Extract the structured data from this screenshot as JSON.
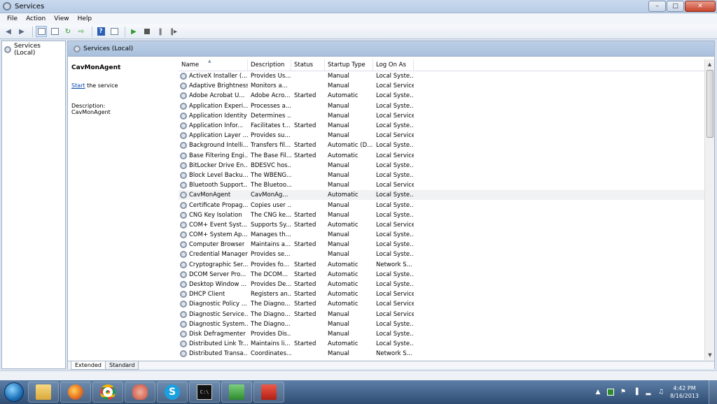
{
  "window": {
    "title": "Services"
  },
  "menu": [
    "File",
    "Action",
    "View",
    "Help"
  ],
  "tree": {
    "root": "Services (Local)"
  },
  "main": {
    "header": "Services (Local)"
  },
  "extended": {
    "service_name": "CavMonAgent",
    "start_link": "Start",
    "start_suffix": " the service",
    "desc_label": "Description:",
    "desc_value": "CavMonAgent"
  },
  "columns": {
    "name": "Name",
    "description": "Description",
    "status": "Status",
    "startup": "Startup Type",
    "logon": "Log On As"
  },
  "services": [
    [
      "ActiveX Installer (...",
      "Provides Us...",
      "",
      "Manual",
      "Local Syste..."
    ],
    [
      "Adaptive Brightness",
      "Monitors a...",
      "",
      "Manual",
      "Local Service"
    ],
    [
      "Adobe Acrobat U...",
      "Adobe Acro...",
      "Started",
      "Automatic",
      "Local Syste..."
    ],
    [
      "Application Experi...",
      "Processes a...",
      "",
      "Manual",
      "Local Syste..."
    ],
    [
      "Application Identity",
      "Determines ...",
      "",
      "Manual",
      "Local Service"
    ],
    [
      "Application Infor...",
      "Facilitates t...",
      "Started",
      "Manual",
      "Local Syste..."
    ],
    [
      "Application Layer ...",
      "Provides su...",
      "",
      "Manual",
      "Local Service"
    ],
    [
      "Background Intelli...",
      "Transfers fil...",
      "Started",
      "Automatic (D...",
      "Local Syste..."
    ],
    [
      "Base Filtering Engi...",
      "The Base Fil...",
      "Started",
      "Automatic",
      "Local Service"
    ],
    [
      "BitLocker Drive En...",
      "BDESVC hos...",
      "",
      "Manual",
      "Local Syste..."
    ],
    [
      "Block Level Backu...",
      "The WBENG...",
      "",
      "Manual",
      "Local Syste..."
    ],
    [
      "Bluetooth Support...",
      "The Bluetoo...",
      "",
      "Manual",
      "Local Service"
    ],
    [
      "CavMonAgent",
      "CavMonAg...",
      "",
      "Automatic",
      "Local Syste..."
    ],
    [
      "Certificate Propag...",
      "Copies user ...",
      "",
      "Manual",
      "Local Syste..."
    ],
    [
      "CNG Key Isolation",
      "The CNG ke...",
      "Started",
      "Manual",
      "Local Syste..."
    ],
    [
      "COM+ Event Syst...",
      "Supports Sy...",
      "Started",
      "Automatic",
      "Local Service"
    ],
    [
      "COM+ System Ap...",
      "Manages th...",
      "",
      "Manual",
      "Local Syste..."
    ],
    [
      "Computer Browser",
      "Maintains a...",
      "Started",
      "Manual",
      "Local Syste..."
    ],
    [
      "Credential Manager",
      "Provides se...",
      "",
      "Manual",
      "Local Syste..."
    ],
    [
      "Cryptographic Ser...",
      "Provides fo...",
      "Started",
      "Automatic",
      "Network S..."
    ],
    [
      "DCOM Server Pro...",
      "The DCOM...",
      "Started",
      "Automatic",
      "Local Syste..."
    ],
    [
      "Desktop Window ...",
      "Provides De...",
      "Started",
      "Automatic",
      "Local Syste..."
    ],
    [
      "DHCP Client",
      "Registers an...",
      "Started",
      "Automatic",
      "Local Service"
    ],
    [
      "Diagnostic Policy ...",
      "The Diagno...",
      "Started",
      "Automatic",
      "Local Service"
    ],
    [
      "Diagnostic Service...",
      "The Diagno...",
      "Started",
      "Manual",
      "Local Service"
    ],
    [
      "Diagnostic System...",
      "The Diagno...",
      "",
      "Manual",
      "Local Syste..."
    ],
    [
      "Disk Defragmenter",
      "Provides Dis...",
      "",
      "Manual",
      "Local Syste..."
    ],
    [
      "Distributed Link Tr...",
      "Maintains li...",
      "Started",
      "Automatic",
      "Local Syste..."
    ],
    [
      "Distributed Transa...",
      "Coordinates...",
      "",
      "Manual",
      "Network S..."
    ]
  ],
  "selected_service": "CavMonAgent",
  "tabs": [
    "Extended",
    "Standard"
  ],
  "clock": {
    "time": "4:42 PM",
    "date": "8/16/2013"
  },
  "taskbar_icons": [
    "start-orb-icon",
    "folder-icon",
    "firefox-icon",
    "chrome-icon",
    "swirl-app-icon",
    "skype-icon",
    "cmd-icon",
    "monitor-app-icon",
    "toolbox-icon"
  ],
  "colors": {
    "link": "#0645ad",
    "taskbar": "#2f4d73",
    "header": "#a9c0dc"
  }
}
